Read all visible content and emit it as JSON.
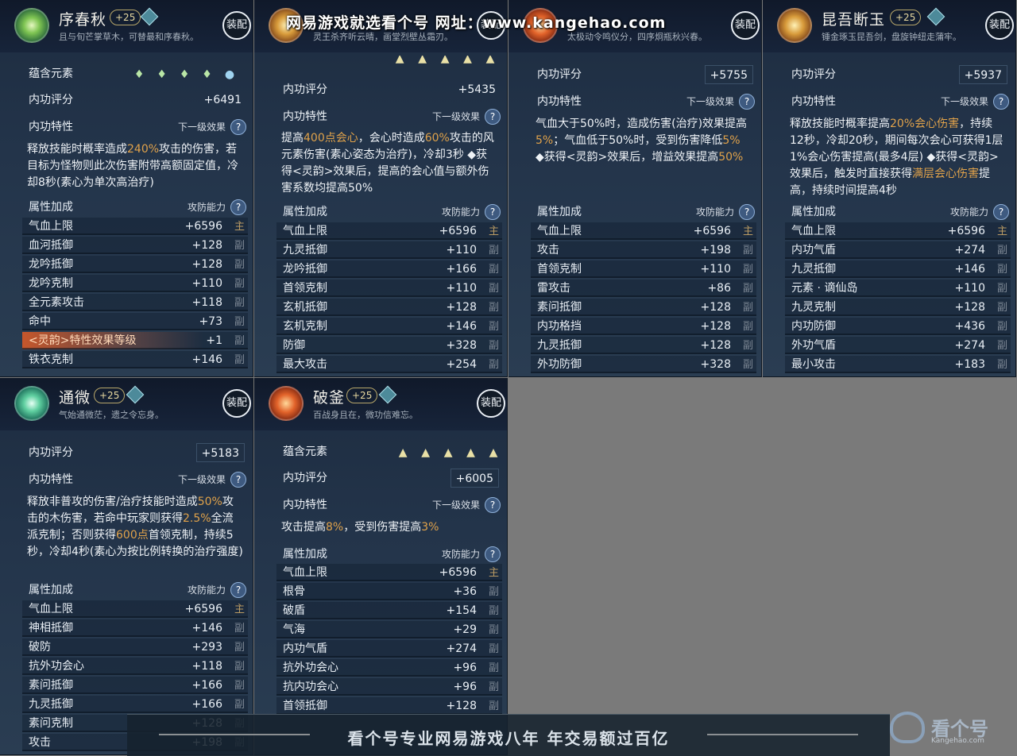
{
  "watermark_top": "网易游戏就选看个号   网址：www.kangehao.com",
  "footer": "看个号专业网易游戏八年   年交易额过百亿",
  "logo": {
    "name": "看个号",
    "site": "Kangehao.com"
  },
  "labels": {
    "equip": "装配",
    "elements": "蕴含元素",
    "score": "内功评分",
    "trait": "内功特性",
    "next_level": "下一级效果",
    "attr_bonus": "属性加成",
    "atk_def": "攻防能力",
    "help": "?"
  },
  "panels": [
    {
      "name": "序春秋",
      "level": "+25",
      "motto": "且与旬芒掌草木，可替最和序春秋。",
      "score": "+6491",
      "desc": [
        {
          "t": "释放技能时概率造成"
        },
        {
          "t": "240%",
          "hl": true
        },
        {
          "t": "攻击的伤害，若目标为怪物则此次伤害附带高额固定值，冷却8秒(素心为单次高治疗)"
        }
      ],
      "attrs": [
        {
          "label": "气血上限",
          "value": "+6596",
          "tag": "主"
        },
        {
          "label": "血河抵御",
          "value": "+128",
          "tag": "副"
        },
        {
          "label": "龙吟抵御",
          "value": "+128",
          "tag": "副"
        },
        {
          "label": "龙吟克制",
          "value": "+110",
          "tag": "副"
        },
        {
          "label": "全元素攻击",
          "value": "+118",
          "tag": "副"
        },
        {
          "label": "命中",
          "value": "+73",
          "tag": "副"
        },
        {
          "label": "<灵韵>特性效果等级",
          "value": "+1",
          "tag": "副"
        },
        {
          "label": "铁衣克制",
          "value": "+146",
          "tag": "副"
        }
      ]
    },
    {
      "name": "",
      "level": "",
      "motto": "灵王杀齐听云晴，画堂烈壁丛霜刃。",
      "score": "+5435",
      "desc": [
        {
          "t": "提高"
        },
        {
          "t": "400点会心",
          "hl": true
        },
        {
          "t": "，会心时造成"
        },
        {
          "t": "60%",
          "hl": true
        },
        {
          "t": "攻击的风元素伤害(素心姿态为治疗)，冷却3秒 ◆获得<灵韵>效果后，提高的会心值与额外伤害系数均提高50%"
        }
      ],
      "attrs": [
        {
          "label": "气血上限",
          "value": "+6596",
          "tag": "主"
        },
        {
          "label": "九灵抵御",
          "value": "+110",
          "tag": "副"
        },
        {
          "label": "龙吟抵御",
          "value": "+166",
          "tag": "副"
        },
        {
          "label": "首领克制",
          "value": "+110",
          "tag": "副"
        },
        {
          "label": "玄机抵御",
          "value": "+128",
          "tag": "副"
        },
        {
          "label": "玄机克制",
          "value": "+146",
          "tag": "副"
        },
        {
          "label": "防御",
          "value": "+328",
          "tag": "副"
        },
        {
          "label": "最大攻击",
          "value": "+254",
          "tag": "副"
        }
      ]
    },
    {
      "name": "",
      "level": "",
      "motto": "太极动令鸣仪分，四序炯瓶秋兴春。",
      "score": "+5755",
      "desc": [
        {
          "t": "气血大于50%时，造成伤害(治疗)效果提高"
        },
        {
          "t": "5%",
          "hl": true
        },
        {
          "t": "；气血低于50%时，受到伤害降低"
        },
        {
          "t": "5%",
          "hl": true
        },
        {
          "t": " ◆获得<灵韵>效果后，增益效果提高"
        },
        {
          "t": "50%",
          "hl": true
        }
      ],
      "attrs": [
        {
          "label": "气血上限",
          "value": "+6596",
          "tag": "主"
        },
        {
          "label": "攻击",
          "value": "+198",
          "tag": "副"
        },
        {
          "label": "首领克制",
          "value": "+110",
          "tag": "副"
        },
        {
          "label": "雷攻击",
          "value": "+86",
          "tag": "副"
        },
        {
          "label": "素问抵御",
          "value": "+128",
          "tag": "副"
        },
        {
          "label": "内功格挡",
          "value": "+128",
          "tag": "副"
        },
        {
          "label": "九灵抵御",
          "value": "+128",
          "tag": "副"
        },
        {
          "label": "外功防御",
          "value": "+328",
          "tag": "副"
        }
      ]
    },
    {
      "name": "昆吾断玉",
      "level": "+25",
      "motto": "锤金琢玉昆吾剑，盘旋钟纽走蒲牢。",
      "score": "+5937",
      "desc": [
        {
          "t": "释放技能时概率提高"
        },
        {
          "t": "20%会心伤害",
          "hl": true
        },
        {
          "t": "，持续12秒，冷却20秒，期间每次会心可获得1层1%会心伤害提高(最多4层) ◆获得<灵韵>效果后，触发时直接获得"
        },
        {
          "t": "满层会心伤害",
          "hl": true
        },
        {
          "t": "提高，持续时间提高4秒"
        }
      ],
      "attrs": [
        {
          "label": "气血上限",
          "value": "+6596",
          "tag": "主"
        },
        {
          "label": "内功气盾",
          "value": "+274",
          "tag": "副"
        },
        {
          "label": "九灵抵御",
          "value": "+146",
          "tag": "副"
        },
        {
          "label": "元素 · 谪仙岛",
          "value": "+110",
          "tag": "副"
        },
        {
          "label": "九灵克制",
          "value": "+128",
          "tag": "副"
        },
        {
          "label": "内功防御",
          "value": "+436",
          "tag": "副"
        },
        {
          "label": "外功气盾",
          "value": "+274",
          "tag": "副"
        },
        {
          "label": "最小攻击",
          "value": "+183",
          "tag": "副"
        }
      ]
    },
    {
      "name": "通微",
      "level": "+25",
      "motto": "气始通微茫，遗之令忘身。",
      "score": "+5183",
      "desc": [
        {
          "t": "释放非普攻的伤害/治疗技能时造成"
        },
        {
          "t": "50%",
          "hl": true
        },
        {
          "t": "攻击的木伤害，若命中玩家则获得"
        },
        {
          "t": "2.5%",
          "hl": true
        },
        {
          "t": "全流派克制；否则获得"
        },
        {
          "t": "600点",
          "hl": true
        },
        {
          "t": "首领克制，持续5秒，冷却4秒(素心为按比例转换的治疗强度)"
        }
      ],
      "attrs": [
        {
          "label": "气血上限",
          "value": "+6596",
          "tag": "主"
        },
        {
          "label": "神相抵御",
          "value": "+146",
          "tag": "副"
        },
        {
          "label": "破防",
          "value": "+293",
          "tag": "副"
        },
        {
          "label": "抗外功会心",
          "value": "+118",
          "tag": "副"
        },
        {
          "label": "素问抵御",
          "value": "+166",
          "tag": "副"
        },
        {
          "label": "九灵抵御",
          "value": "+166",
          "tag": "副"
        },
        {
          "label": "素问克制",
          "value": "+128",
          "tag": "副"
        },
        {
          "label": "攻击",
          "value": "+198",
          "tag": "副"
        }
      ]
    },
    {
      "name": "破釜",
      "level": "+25",
      "motto": "百战身且在，微功信难忘。",
      "score": "+6005",
      "desc": [
        {
          "t": "攻击提高"
        },
        {
          "t": "8%",
          "hl": true
        },
        {
          "t": "，受到伤害提高"
        },
        {
          "t": "3%",
          "hl": true
        }
      ],
      "attrs": [
        {
          "label": "气血上限",
          "value": "+6596",
          "tag": "主"
        },
        {
          "label": "根骨",
          "value": "+36",
          "tag": "副"
        },
        {
          "label": "破盾",
          "value": "+154",
          "tag": "副"
        },
        {
          "label": "气海",
          "value": "+29",
          "tag": "副"
        },
        {
          "label": "内功气盾",
          "value": "+274",
          "tag": "副"
        },
        {
          "label": "抗外功会心",
          "value": "+96",
          "tag": "副"
        },
        {
          "label": "抗内功会心",
          "value": "+96",
          "tag": "副"
        },
        {
          "label": "首领抵御",
          "value": "+128",
          "tag": "副"
        }
      ]
    }
  ]
}
